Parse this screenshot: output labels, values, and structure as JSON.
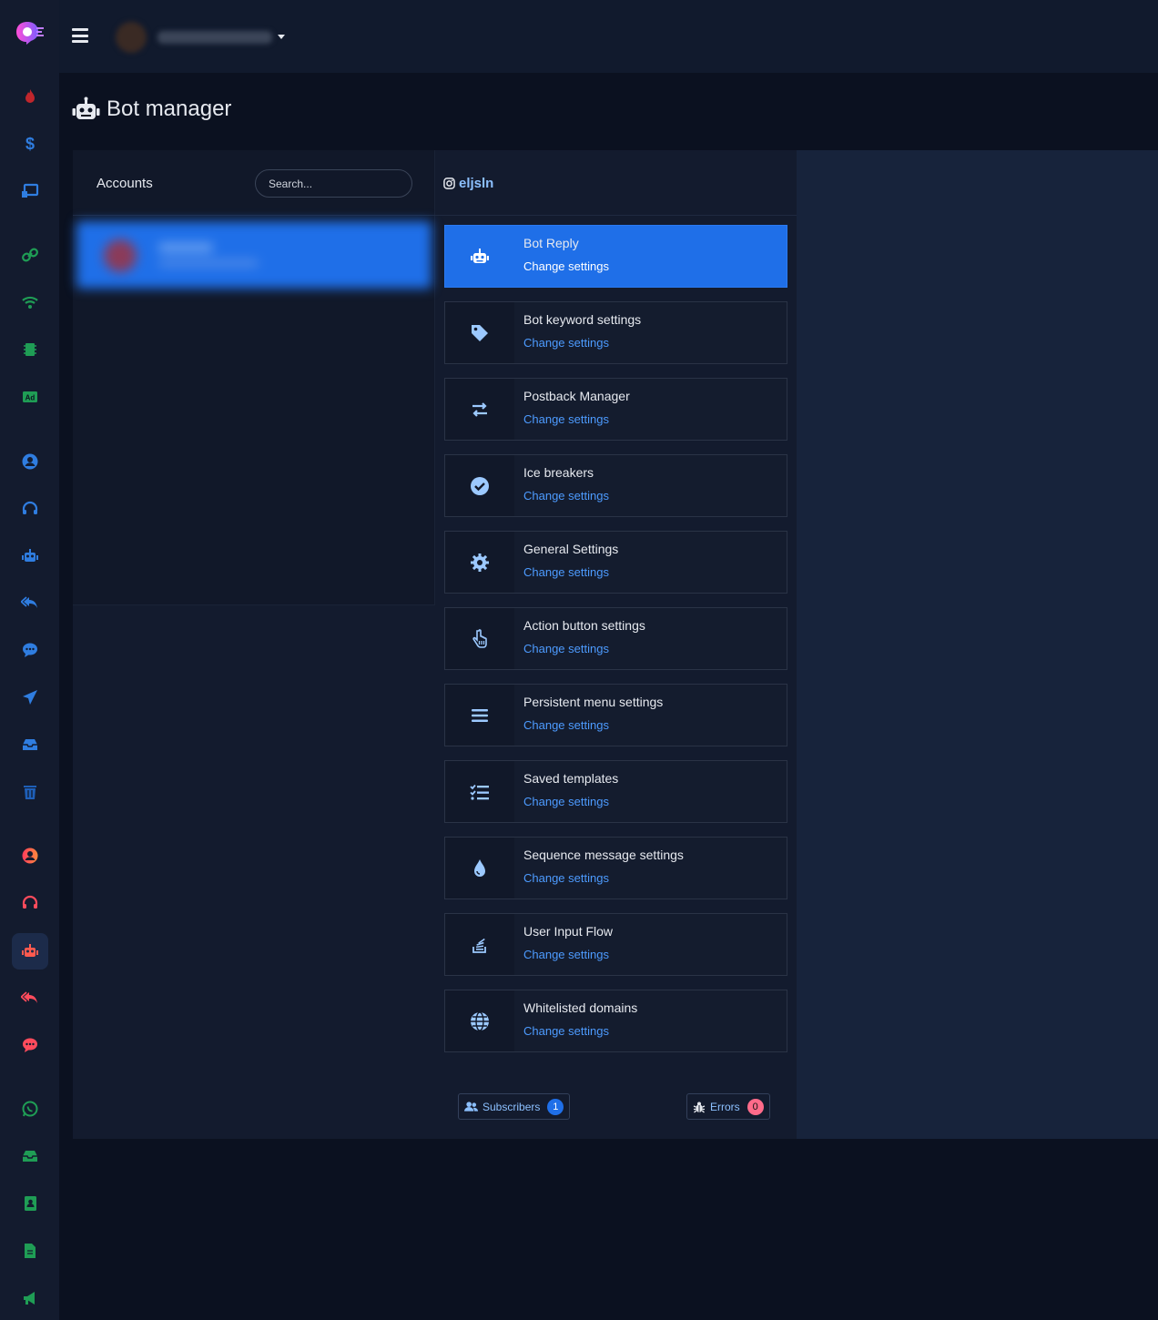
{
  "page": {
    "title": "Bot manager"
  },
  "accounts": {
    "label": "Accounts",
    "search_placeholder": "Search..."
  },
  "detail": {
    "handle": "eljsln"
  },
  "settings": [
    {
      "title": "Bot Reply",
      "link": "Change settings",
      "icon": "robot-icon",
      "active": true
    },
    {
      "title": "Bot keyword settings",
      "link": "Change settings",
      "icon": "tag-icon"
    },
    {
      "title": "Postback Manager",
      "link": "Change settings",
      "icon": "exchange-arrows-icon"
    },
    {
      "title": "Ice breakers",
      "link": "Change settings",
      "icon": "check-circle-icon"
    },
    {
      "title": "General Settings",
      "link": "Change settings",
      "icon": "gear-icon"
    },
    {
      "title": "Action button settings",
      "link": "Change settings",
      "icon": "hand-pointer-icon"
    },
    {
      "title": "Persistent menu settings",
      "link": "Change settings",
      "icon": "bars-icon"
    },
    {
      "title": "Saved templates",
      "link": "Change settings",
      "icon": "checklist-icon"
    },
    {
      "title": "Sequence message settings",
      "link": "Change settings",
      "icon": "droplet-icon"
    },
    {
      "title": "User Input Flow",
      "link": "Change settings",
      "icon": "stack-icon"
    },
    {
      "title": "Whitelisted domains",
      "link": "Change settings",
      "icon": "globe-icon"
    }
  ],
  "footer": {
    "subscribers_label": "Subscribers",
    "subscribers_count": "1",
    "errors_label": "Errors",
    "errors_count": "0"
  },
  "colors": {
    "accent": "#1f6fe8",
    "link": "#4d9bff",
    "bg": "#0b1120",
    "card": "#131b2e"
  }
}
